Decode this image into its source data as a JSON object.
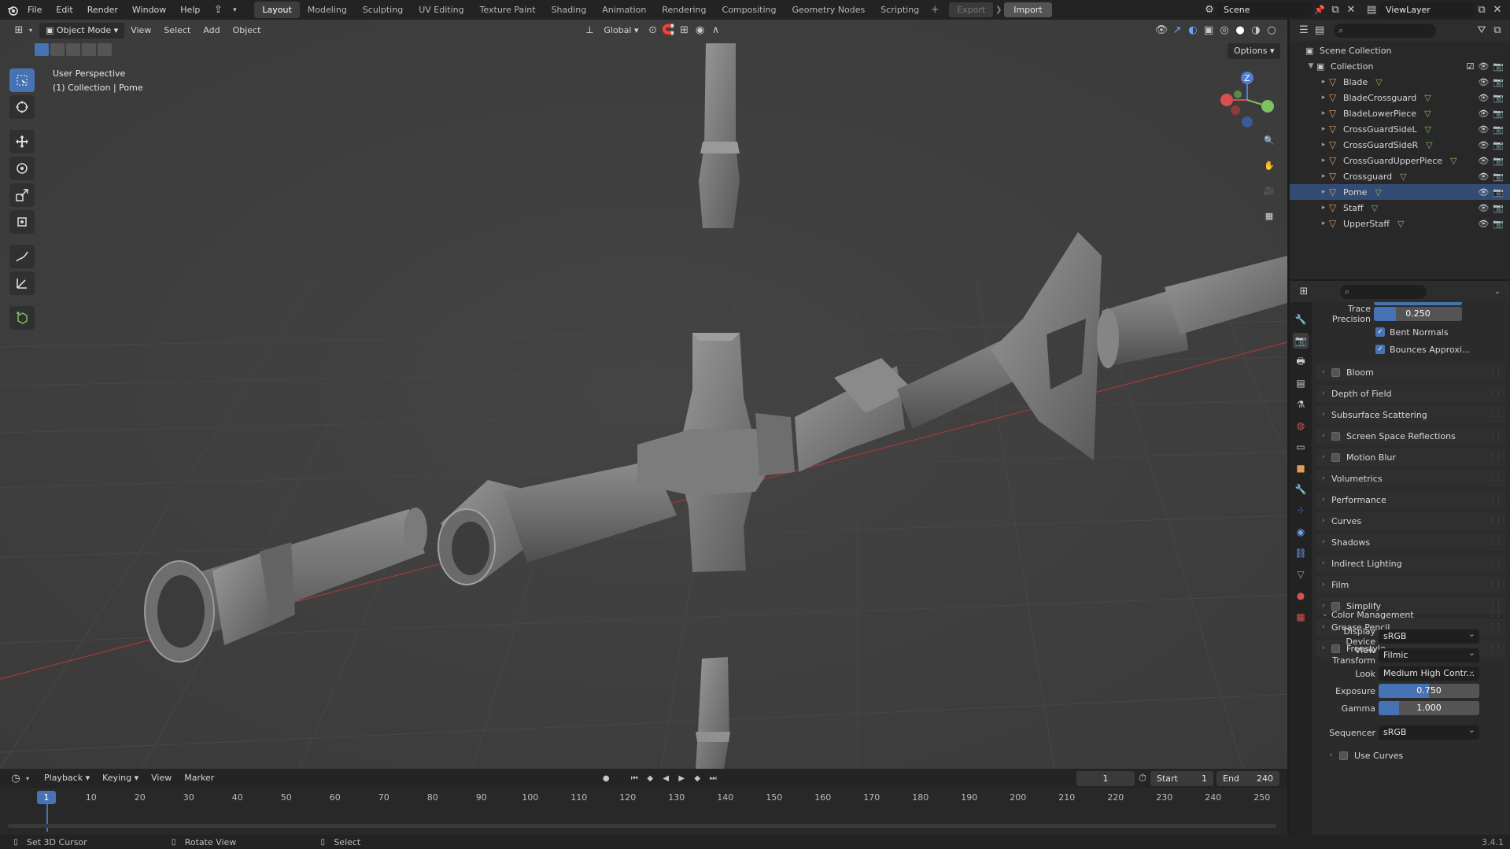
{
  "topbar": {
    "menus": [
      "File",
      "Edit",
      "Render",
      "Window",
      "Help"
    ],
    "workspaces": [
      "Layout",
      "Modeling",
      "Sculpting",
      "UV Editing",
      "Texture Paint",
      "Shading",
      "Animation",
      "Rendering",
      "Compositing",
      "Geometry Nodes",
      "Scripting"
    ],
    "active_workspace": "Layout",
    "export_label": "Export",
    "import_label": "Import",
    "scene_name": "Scene",
    "view_layer": "ViewLayer"
  },
  "viewport": {
    "mode": "Object Mode",
    "menus": [
      "View",
      "Select",
      "Add",
      "Object"
    ],
    "transform_orientation": "Global",
    "options_label": "Options",
    "overlay_line1": "User Perspective",
    "overlay_line2": "(1) Collection | Pome",
    "gizmo_z": "Z"
  },
  "timeline": {
    "menus": [
      "Playback",
      "Keying",
      "View",
      "Marker"
    ],
    "current_frame": "1",
    "start_label": "Start",
    "start_value": "1",
    "end_label": "End",
    "end_value": "240",
    "ticks": [
      "10",
      "20",
      "30",
      "40",
      "50",
      "60",
      "70",
      "80",
      "90",
      "100",
      "110",
      "120",
      "130",
      "140",
      "150",
      "160",
      "170",
      "180",
      "190",
      "200",
      "210",
      "220",
      "230",
      "240",
      "250"
    ]
  },
  "statusbar": {
    "hint1": "Set 3D Cursor",
    "hint2": "Rotate View",
    "hint3": "Select",
    "version": "3.4.1"
  },
  "outliner": {
    "root": "Scene Collection",
    "collection": "Collection",
    "items": [
      "Blade",
      "BladeCrossguard",
      "BladeLowerPiece",
      "CrossGuardSideL",
      "CrossGuardSideR",
      "CrossGuardUpperPiece",
      "Crossguard",
      "Pome",
      "Staff",
      "UpperStaff"
    ],
    "selected": "Pome"
  },
  "properties": {
    "trace_precision_label": "Trace Precision",
    "trace_precision_value": "0.250",
    "bent_normals": "Bent Normals",
    "bounces_approx": "Bounces Approxi...",
    "panels": [
      {
        "label": "Bloom",
        "checkbox": true
      },
      {
        "label": "Depth of Field",
        "checkbox": false
      },
      {
        "label": "Subsurface Scattering",
        "checkbox": false
      },
      {
        "label": "Screen Space Reflections",
        "checkbox": true
      },
      {
        "label": "Motion Blur",
        "checkbox": true
      },
      {
        "label": "Volumetrics",
        "checkbox": false
      },
      {
        "label": "Performance",
        "checkbox": false
      },
      {
        "label": "Curves",
        "checkbox": false
      },
      {
        "label": "Shadows",
        "checkbox": false
      },
      {
        "label": "Indirect Lighting",
        "checkbox": false
      },
      {
        "label": "Film",
        "checkbox": false
      },
      {
        "label": "Simplify",
        "checkbox": true
      },
      {
        "label": "Grease Pencil",
        "checkbox": false
      },
      {
        "label": "Freestyle",
        "checkbox": true
      }
    ],
    "color_management": {
      "title": "Color Management",
      "display_device_label": "Display Device",
      "display_device": "sRGB",
      "view_transform_label": "View Transform",
      "view_transform": "Filmic",
      "look_label": "Look",
      "look": "Medium High Contr...",
      "exposure_label": "Exposure",
      "exposure": "0.750",
      "exposure_fill": 0.5,
      "gamma_label": "Gamma",
      "gamma": "1.000",
      "gamma_fill": 0.2,
      "sequencer_label": "Sequencer",
      "sequencer": "sRGB",
      "use_curves": "Use Curves"
    }
  },
  "colors": {
    "accent": "#4772b3",
    "viewport_bg": "#3d3d3d",
    "object_orange": "#e69a5a",
    "mesh_green": "#7ec15f"
  }
}
